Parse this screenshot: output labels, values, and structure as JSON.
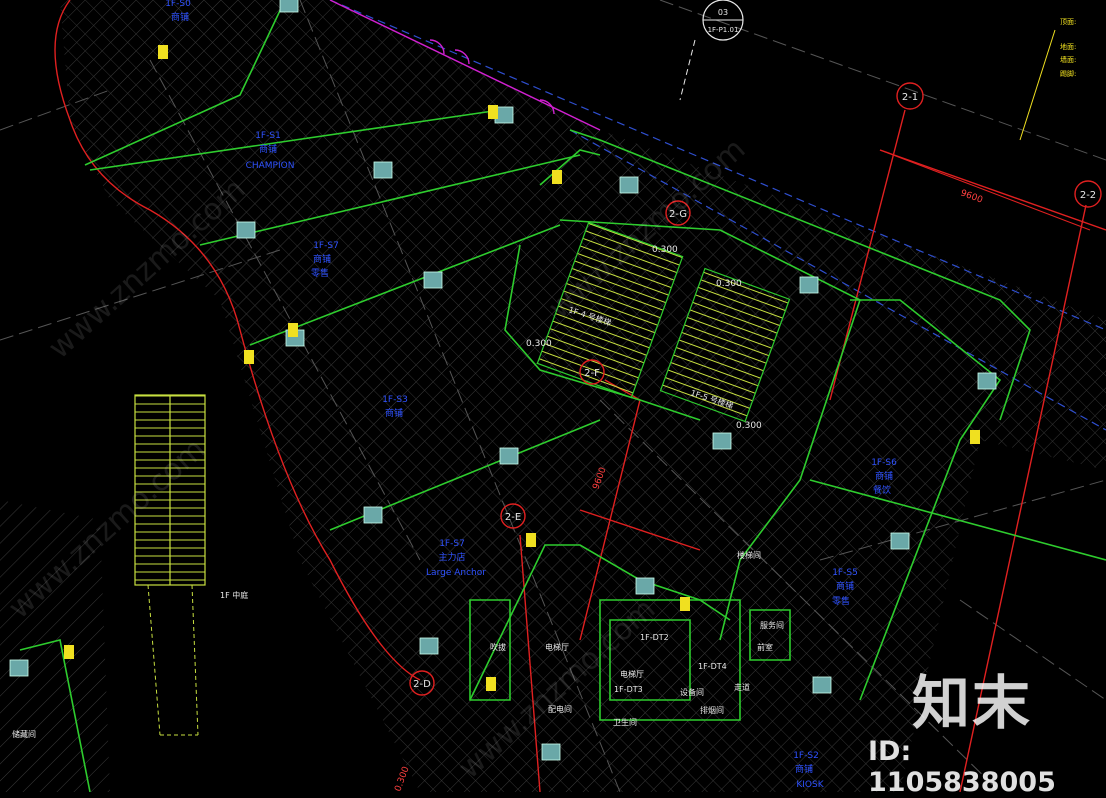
{
  "colors": {
    "background": "#000000",
    "wall_green": "#2ecc2e",
    "boundary_red": "#e02020",
    "grid_blue": "#2f4fd0",
    "room_text_blue": "#2f52ff",
    "stair_yellow": "#c8e040",
    "column_cyan": "#66cccc",
    "door_magenta": "#d020d0",
    "hatch_grey": "#4a4a4a",
    "text_white": "#e8e8e8",
    "tag_red": "#ff3030"
  },
  "grid_tags": [
    "2-1",
    "2-2",
    "2-G",
    "2-F",
    "2-E",
    "2-D"
  ],
  "dimensions": [
    "9600",
    "9600",
    "0.300",
    "0.300",
    "0.300",
    "0.300",
    "0.300"
  ],
  "stair_labels": [
    "1F-4 号楼梯",
    "1F-5 号楼梯"
  ],
  "room_labels": [
    "服务间",
    "楼梯间",
    "前室",
    "走道",
    "电梯厅",
    "设备间",
    "排烟间",
    "卫生间",
    "配电间",
    "储藏间",
    "1F 中庭",
    "吹拔",
    "电梯厅"
  ],
  "elevator_labels": [
    "1F-DT2",
    "1F-DT3",
    "1F-DT4"
  ],
  "shop_blocks": [
    {
      "code": "1F-S1",
      "name": "商铺",
      "sub": "CHAMPION"
    },
    {
      "code": "1F-S7",
      "name": "商铺",
      "sub": "零售"
    },
    {
      "code": "1F-S3",
      "name": "商铺",
      "sub": ""
    },
    {
      "code": "1F-S7",
      "name": "主力店",
      "sub": "Large Anchor"
    },
    {
      "code": "1F-S6",
      "name": "商铺",
      "sub": "餐饮"
    },
    {
      "code": "1F-S5",
      "name": "商铺",
      "sub": "零售"
    },
    {
      "code": "1F-S2",
      "name": "商铺",
      "sub": "KIOSK"
    },
    {
      "code": "1F-S0",
      "name": "商铺",
      "sub": ""
    }
  ],
  "section_tag": {
    "top": "03",
    "bottom": "1F-P1.01"
  },
  "notes_top_right": [
    "顶面:",
    "地面:",
    "墙面:",
    "踢脚:"
  ],
  "watermarks": {
    "logo": "知末",
    "id": "ID: 1105838005",
    "diagonal": "www.znzmo.com"
  }
}
